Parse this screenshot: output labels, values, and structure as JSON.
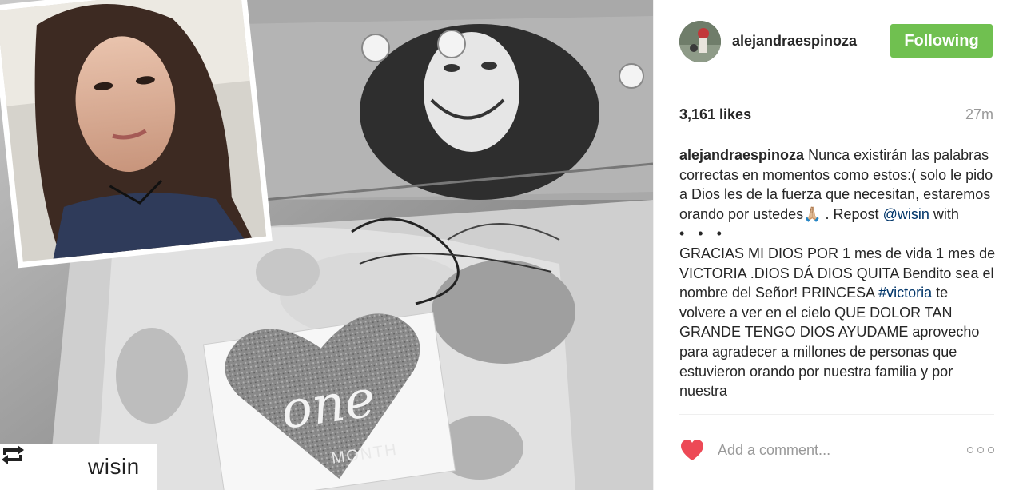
{
  "post": {
    "username": "alejandraespinoza",
    "follow_label": "Following",
    "likes": "3,161 likes",
    "time": "27m",
    "caption": {
      "user": "alejandraespinoza",
      "part1": " Nunca existirán las palabras correctas en momentos como estos:( solo le pido a Dios les de la fuerza que necesitan, estaremos orando por ustedes🙏🏼 . Repost ",
      "mention": "@wisin",
      "part2": " with",
      "dots": "• • •",
      "part3": "GRACIAS MI DIOS POR 1 mes de vida 1 mes de VICTORIA .DIOS DÁ DIOS QUITA Bendito sea el nombre del Señor! PRINCESA ",
      "hashtag": "#victoria",
      "part4": " te volvere a ver en el cielo QUE DOLOR TAN GRANDE TENGO DIOS AYUDAME aprovecho para agradecer a millones de personas que estuvieron orando por nuestra familia y por nuestra"
    },
    "comment_placeholder": "Add a comment..."
  },
  "photo": {
    "repost_user": "wisin",
    "card_word": "one",
    "card_sub": "MONTH"
  },
  "colors": {
    "follow_green": "#70c050",
    "like_red": "#ed4956",
    "link_blue": "#003569"
  }
}
